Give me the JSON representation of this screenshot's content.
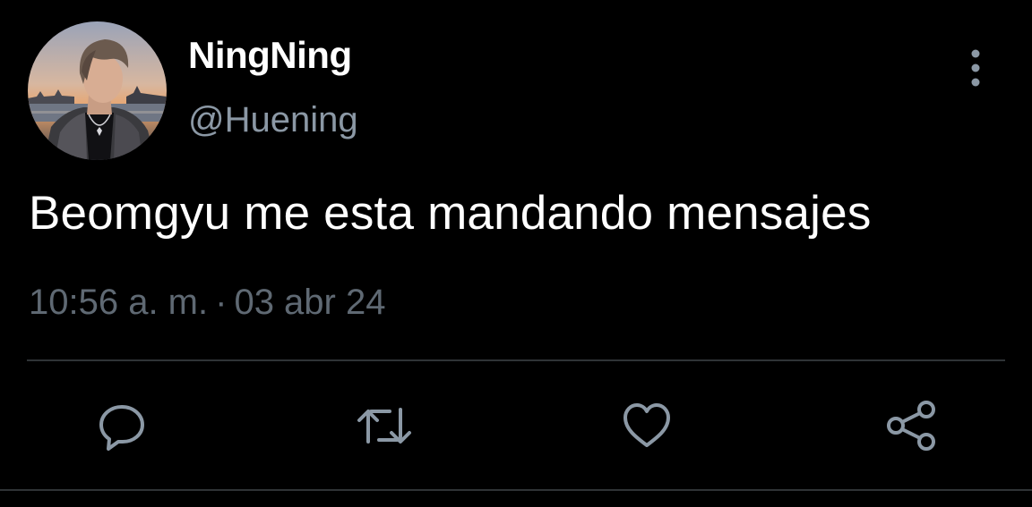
{
  "tweet": {
    "author": {
      "display_name": "NingNing",
      "handle": "@Huening",
      "avatar_icon": "profile-photo"
    },
    "text": "Beomgyu me esta mandando mensajes",
    "time": "10:56 a. m.",
    "separator": "·",
    "date": "03 abr 24"
  },
  "actions": [
    {
      "name": "reply",
      "icon": "reply-icon"
    },
    {
      "name": "retweet",
      "icon": "retweet-icon"
    },
    {
      "name": "like",
      "icon": "heart-icon"
    },
    {
      "name": "share",
      "icon": "share-icon"
    }
  ],
  "colors": {
    "background": "#000000",
    "primary_text": "#ffffff",
    "secondary_text": "#8b98a5",
    "meta_text": "#5f6973",
    "icon": "#8b98a5",
    "divider": "#2f3336"
  }
}
